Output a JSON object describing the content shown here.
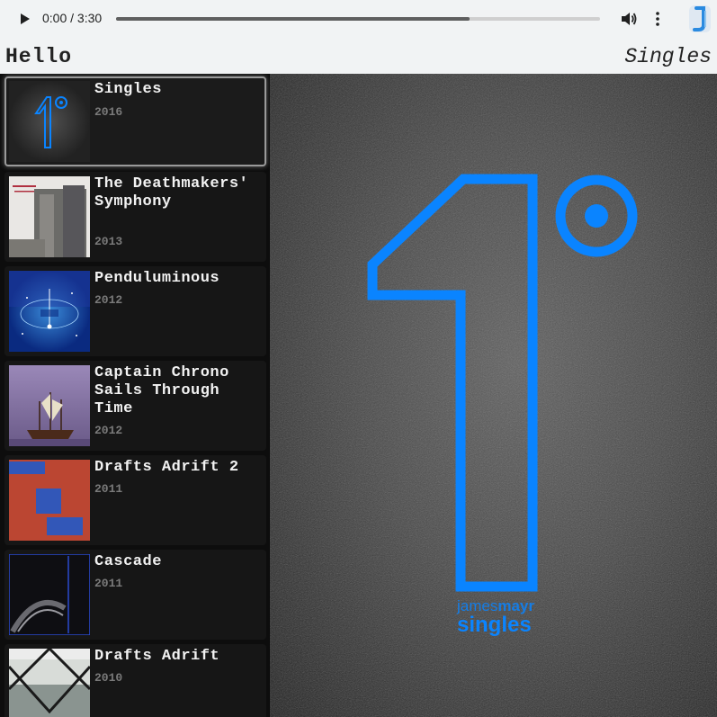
{
  "player": {
    "time_display": "0:00 / 3:30",
    "progress_fraction": 0.73
  },
  "header": {
    "greeting": "Hello",
    "title": "Singles"
  },
  "albums": [
    {
      "title": "Singles",
      "year": "2016",
      "selected": true
    },
    {
      "title": "The Deathmakers' Symphony",
      "year": "2013"
    },
    {
      "title": "Penduluminous",
      "year": "2012"
    },
    {
      "title": "Captain Chrono Sails Through Time",
      "year": "2012"
    },
    {
      "title": "Drafts Adrift 2",
      "year": "2011"
    },
    {
      "title": "Cascade",
      "year": "2011"
    },
    {
      "title": "Drafts Adrift",
      "year": "2010"
    }
  ],
  "artwork": {
    "artist_prefix": "james",
    "artist_suffix": "mayr",
    "album_word": "singles",
    "accent_color": "#0a84ff"
  },
  "icons": {
    "play": "play-icon",
    "volume": "volume-icon",
    "menu": "more-vert-icon",
    "extension": "extension-icon"
  }
}
